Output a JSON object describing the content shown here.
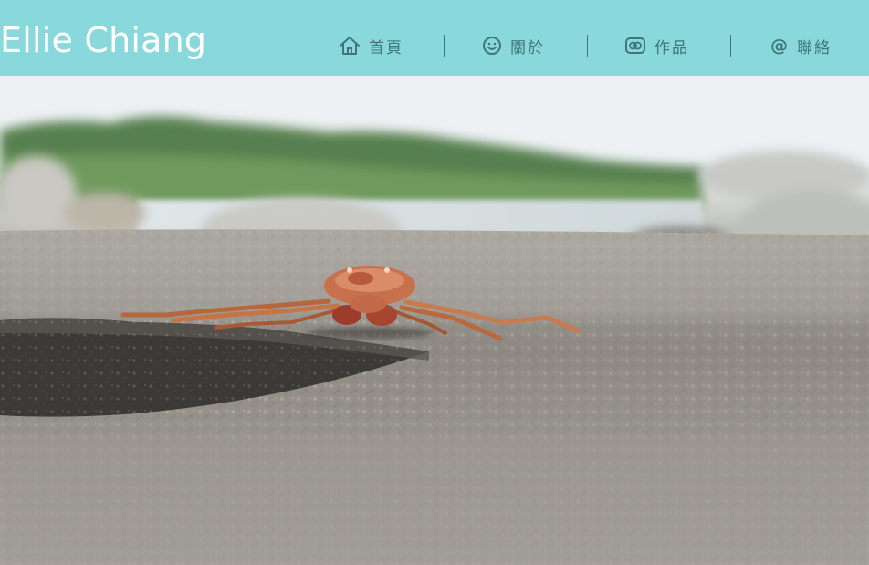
{
  "header": {
    "brand": "Ellie Chiang",
    "background_color": "#89d8db",
    "text_color": "#40757a"
  },
  "nav": {
    "items": [
      {
        "label": "首頁",
        "icon": "home-icon"
      },
      {
        "label": "關於",
        "icon": "smiley-icon"
      },
      {
        "label": "作品",
        "icon": "camera-icon"
      },
      {
        "label": "聯絡",
        "icon": "at-sign-icon"
      }
    ]
  },
  "hero": {
    "subject": "crab-on-rock-photo"
  }
}
